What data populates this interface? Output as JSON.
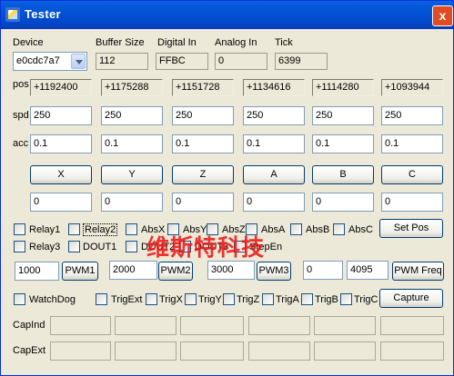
{
  "window": {
    "title": "Tester",
    "close_label": "x"
  },
  "top": {
    "device_label": "Device",
    "device_value": "e0cdc7a7",
    "buffer_label": "Buffer Size",
    "buffer_value": "112",
    "digital_label": "Digital In",
    "digital_value": "FFBC",
    "analog_label": "Analog In",
    "analog_value": "0",
    "tick_label": "Tick",
    "tick_value": "6399"
  },
  "axes": {
    "pos_label": "pos",
    "spd_label": "spd",
    "acc_label": "acc",
    "pos": [
      "+1192400",
      "+1175288",
      "+1151728",
      "+1134616",
      "+1114280",
      "+1093944"
    ],
    "spd": [
      "250",
      "250",
      "250",
      "250",
      "250",
      "250"
    ],
    "acc": [
      "0.1",
      "0.1",
      "0.1",
      "0.1",
      "0.1",
      "0.1"
    ],
    "buttons": [
      "X",
      "Y",
      "Z",
      "A",
      "B",
      "C"
    ],
    "targets": [
      "0",
      "0",
      "0",
      "0",
      "0",
      "0"
    ]
  },
  "checks_row1": [
    "Relay1",
    "Relay2",
    "AbsX",
    "AbsY",
    "AbsZ",
    "AbsA",
    "AbsB",
    "AbsC"
  ],
  "set_pos_label": "Set Pos",
  "checks_row2": [
    "Relay3",
    "DOUT1",
    "DOUT2",
    "DOUT3",
    "StepEn"
  ],
  "pwm": {
    "v1": "1000",
    "b1": "PWM1",
    "v2": "2000",
    "b2": "PWM2",
    "v3": "3000",
    "b3": "PWM3",
    "f1": "0",
    "f2": "4095",
    "freq_label": "PWM Freq"
  },
  "checks_row3": [
    "WatchDog",
    "TrigExt",
    "TrigX",
    "TrigY",
    "TrigZ",
    "TrigA",
    "TrigB",
    "TrigC"
  ],
  "capture_label": "Capture",
  "cap_ind_label": "CapInd",
  "cap_ext_label": "CapExt",
  "watermark": "维斯特科技"
}
